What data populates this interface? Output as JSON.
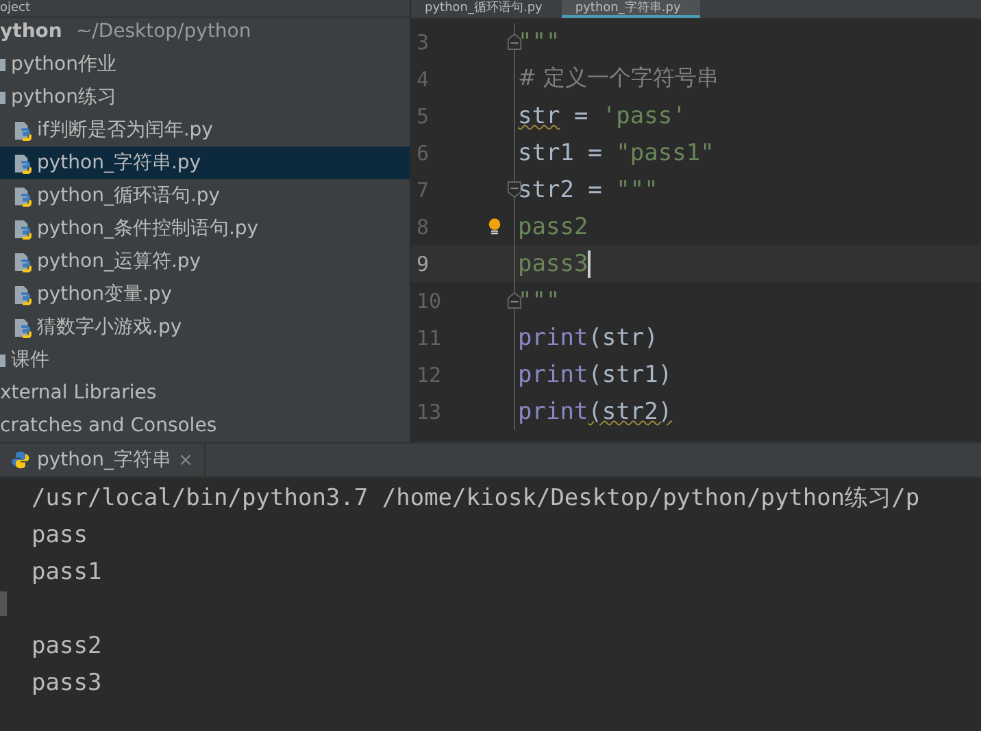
{
  "project_header": {
    "title": "oject"
  },
  "editor_tabs": [
    {
      "label": "python_循环语句.py",
      "selected": false
    },
    {
      "label": "python_字符串.py",
      "selected": true
    }
  ],
  "tree": {
    "root": {
      "label": "ython",
      "path": "~/Desktop/python",
      "children": [
        {
          "label": "python作业",
          "kind": "folder",
          "selected": false
        },
        {
          "label": "python练习",
          "kind": "folder",
          "selected": false,
          "children": [
            {
              "label": "if判断是否为闰年.py",
              "kind": "file",
              "selected": false
            },
            {
              "label": "python_字符串.py",
              "kind": "file",
              "selected": true
            },
            {
              "label": "python_循环语句.py",
              "kind": "file",
              "selected": false
            },
            {
              "label": "python_条件控制语句.py",
              "kind": "file",
              "selected": false
            },
            {
              "label": "python_运算符.py",
              "kind": "file",
              "selected": false
            },
            {
              "label": "python变量.py",
              "kind": "file",
              "selected": false
            },
            {
              "label": "猜数字小游戏.py",
              "kind": "file",
              "selected": false
            }
          ]
        },
        {
          "label": "课件",
          "kind": "folder",
          "selected": false
        }
      ]
    },
    "extra": [
      {
        "label": "xternal Libraries"
      },
      {
        "label": "cratches and Consoles"
      }
    ]
  },
  "code": [
    {
      "number": "3",
      "current": false,
      "fold_start": false,
      "fold_end": true,
      "tokens": [
        {
          "kind": "string",
          "text": "\"\"\""
        }
      ]
    },
    {
      "number": "4",
      "current": false,
      "fold_start": false,
      "fold_end": false,
      "tokens": [
        {
          "kind": "comment",
          "text": "# 定义一个字符号串"
        }
      ]
    },
    {
      "number": "5",
      "current": false,
      "fold_start": false,
      "fold_end": false,
      "tokens": [
        {
          "kind": "warn",
          "text": "str"
        },
        {
          "kind": "plain",
          "text": " = "
        },
        {
          "kind": "string",
          "text": "'pass'"
        }
      ]
    },
    {
      "number": "6",
      "current": false,
      "fold_start": false,
      "fold_end": false,
      "tokens": [
        {
          "kind": "plain",
          "text": "str1 = "
        },
        {
          "kind": "string",
          "text": "\"pass1\""
        }
      ]
    },
    {
      "number": "7",
      "current": false,
      "fold_start": true,
      "fold_end": false,
      "tokens": [
        {
          "kind": "plain",
          "text": "str2 = "
        },
        {
          "kind": "string",
          "text": "\"\"\""
        }
      ]
    },
    {
      "number": "8",
      "current": false,
      "fold_start": false,
      "fold_end": false,
      "bulb": true,
      "tokens": [
        {
          "kind": "string",
          "text": "pass2"
        }
      ]
    },
    {
      "number": "9",
      "current": true,
      "fold_start": false,
      "fold_end": false,
      "tokens": [
        {
          "kind": "string",
          "text": "pass3"
        }
      ]
    },
    {
      "number": "10",
      "current": false,
      "fold_start": false,
      "fold_end": true,
      "tokens": [
        {
          "kind": "string",
          "text": "\"\"\""
        }
      ]
    },
    {
      "number": "11",
      "current": false,
      "fold_start": false,
      "fold_end": false,
      "tokens": [
        {
          "kind": "keyword",
          "text": "print"
        },
        {
          "kind": "plain",
          "text": "(str)"
        }
      ]
    },
    {
      "number": "12",
      "current": false,
      "fold_start": false,
      "fold_end": false,
      "tokens": [
        {
          "kind": "keyword",
          "text": "print"
        },
        {
          "kind": "plain",
          "text": "(str1)"
        }
      ]
    },
    {
      "number": "13",
      "current": false,
      "fold_start": false,
      "fold_end": false,
      "tokens": [
        {
          "kind": "keyword",
          "text": "print"
        },
        {
          "kind": "warn",
          "text": "(str2)"
        }
      ]
    }
  ],
  "run_panel": {
    "tab": {
      "label": "python_字符串",
      "close": "×"
    },
    "output_blocks": [
      [
        "/usr/local/bin/python3.7 /home/kiosk/Desktop/python/python练习/p",
        "pass",
        "pass1"
      ],
      [
        "pass2",
        "pass3"
      ]
    ]
  }
}
